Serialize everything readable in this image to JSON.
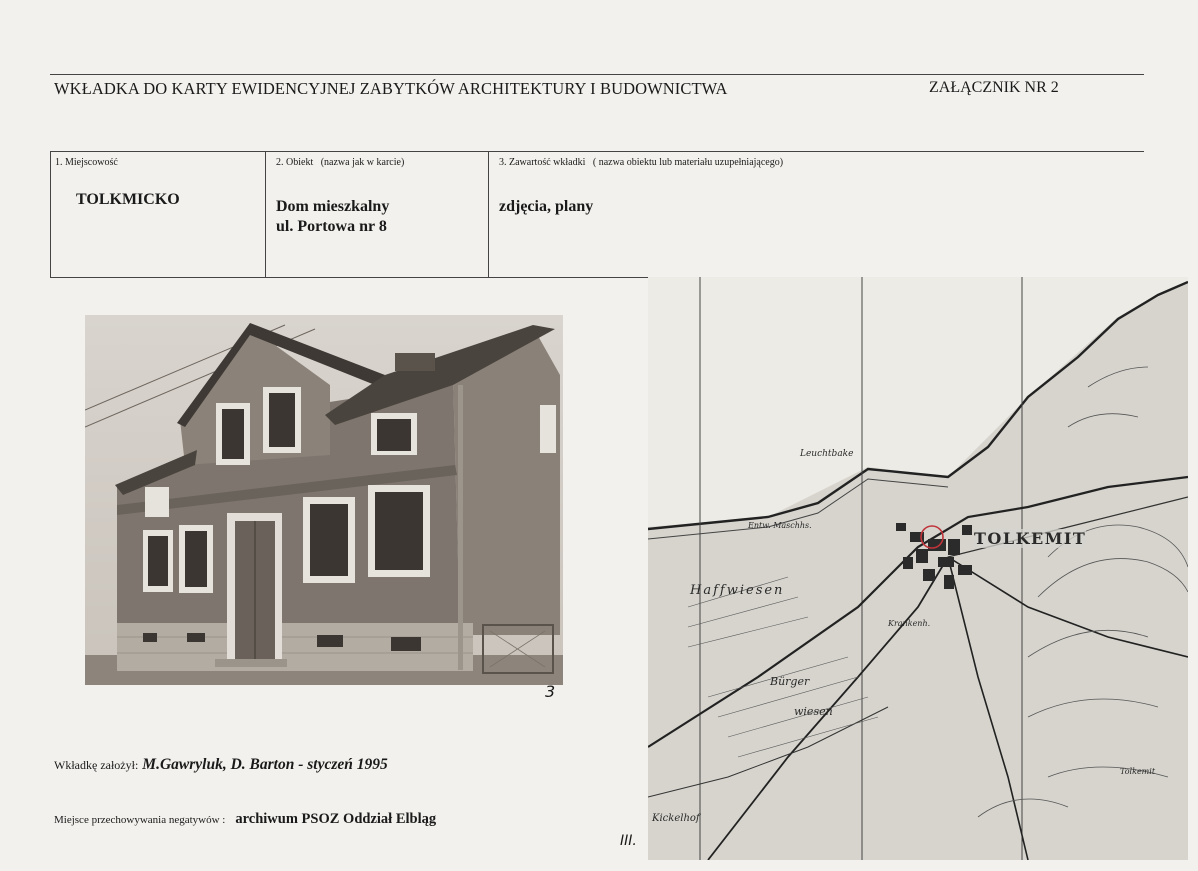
{
  "header": {
    "title": "WKŁADKA DO KARTY EWIDENCYJNEJ ZABYTKÓW ARCHITEKTURY I BUDOWNICTWA",
    "annex": "ZAŁĄCZNIK NR 2"
  },
  "fields": {
    "location": {
      "label": "1. Miejscowość",
      "value": "TOLKMICKO"
    },
    "object": {
      "label": "2. Obiekt   (nazwa jak w karcie)",
      "value_line1": "Dom mieszkalny",
      "value_line2": "ul. Portowa nr 8"
    },
    "content": {
      "label": "3. Zawartość wkładki   ( nazwa obiektu lub materiału uzupełniającego)",
      "value": "zdjęcia, plany"
    }
  },
  "photo": {
    "number": "3"
  },
  "map": {
    "town_label": "TOLKEMIT",
    "labels": [
      "Leuchtbake",
      "Entw. Maschhs.",
      "Haffwiesen",
      "Bürger",
      "wiesen",
      "Kickelhof",
      "Krankenh.",
      "Tolkemit"
    ],
    "sheet_number": "III."
  },
  "footer": {
    "founder_label": "Wkładkę założył:",
    "founder_value": "M.Gawryluk, D. Barton - styczeń 1995",
    "negatives_label": "Miejsce przechowywania negatywów :",
    "negatives_value": "archiwum PSOZ Oddział Elbląg"
  }
}
